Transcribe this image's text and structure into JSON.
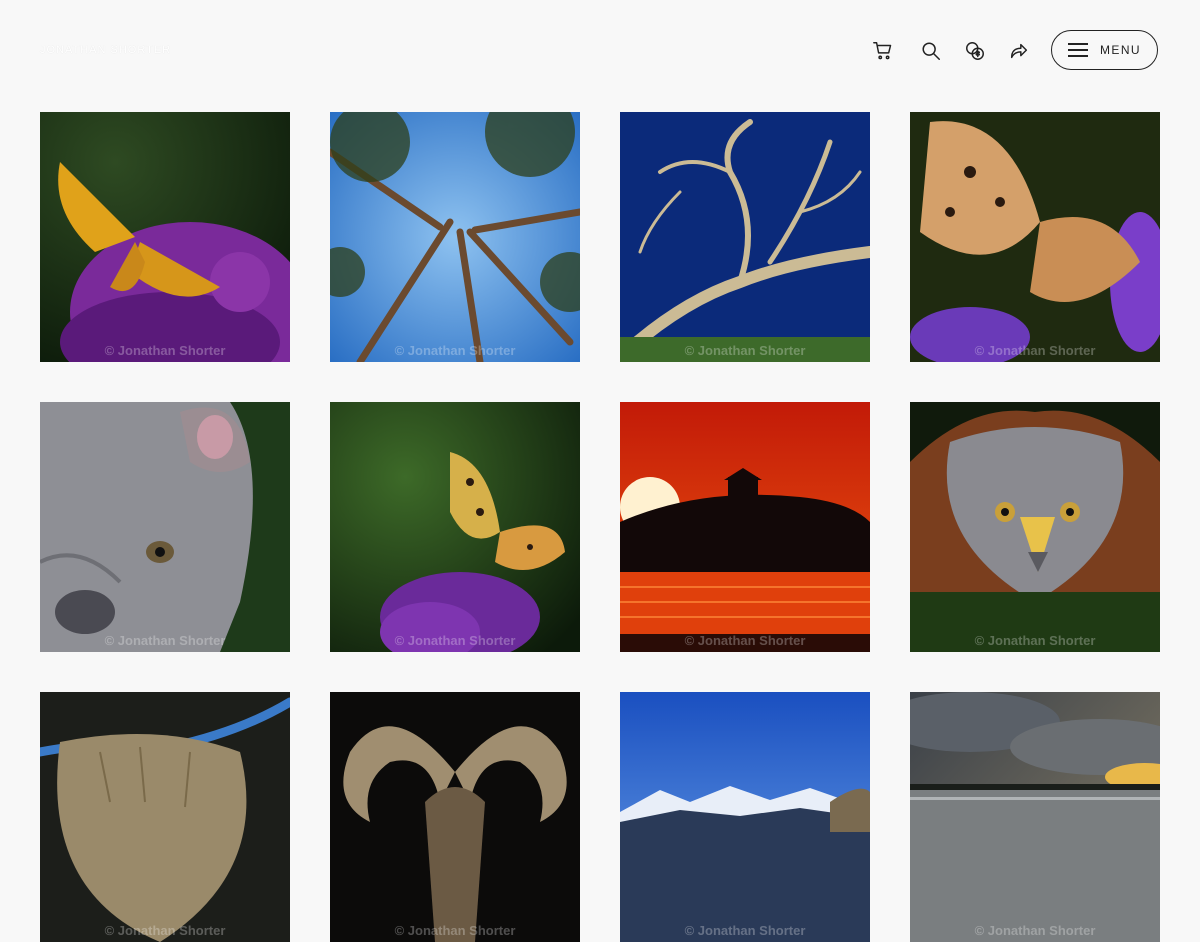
{
  "header": {
    "logo_text": "JONATHAN SHORTER",
    "icons": [
      "cart-icon",
      "search-icon",
      "currency-icon",
      "share-icon"
    ],
    "menu_label": "MENU"
  },
  "gallery": {
    "watermark": "© Jonathan Shorter",
    "tiles": [
      {
        "subject": "butterfly-on-purple-flower"
      },
      {
        "subject": "pine-trees-from-below"
      },
      {
        "subject": "dead-tree-blue-sky"
      },
      {
        "subject": "painted-lady-butterfly"
      },
      {
        "subject": "french-bulldog"
      },
      {
        "subject": "butterfly-on-buddleia"
      },
      {
        "subject": "red-sunset-silhouette"
      },
      {
        "subject": "harris-hawk"
      },
      {
        "subject": "highland-cow"
      },
      {
        "subject": "ram-horns"
      },
      {
        "subject": "snowy-mountains"
      },
      {
        "subject": "cloudy-lake-sunset"
      }
    ]
  }
}
